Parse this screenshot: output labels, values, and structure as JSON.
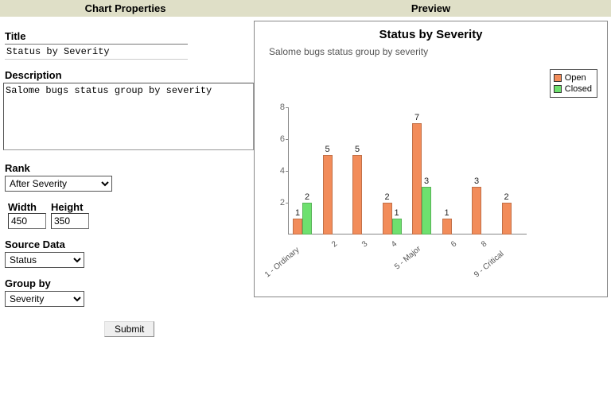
{
  "headers": {
    "left": "Chart Properties",
    "right": "Preview"
  },
  "form": {
    "title_label": "Title",
    "title_value": "Status by Severity",
    "desc_label": "Description",
    "desc_value": "Salome bugs status group by severity",
    "rank_label": "Rank",
    "rank_selected": "After Severity",
    "width_label": "Width",
    "height_label": "Height",
    "width_value": "450",
    "height_value": "350",
    "source_label": "Source Data",
    "source_selected": "Status",
    "group_label": "Group by",
    "group_selected": "Severity",
    "submit_label": "Submit"
  },
  "chart_data": {
    "type": "bar",
    "title": "Status by Severity",
    "subtitle": "Salome bugs status group by severity",
    "xlabel": "",
    "ylabel": "",
    "ylim": [
      0,
      8
    ],
    "yticks": [
      2,
      4,
      6,
      8
    ],
    "legend": {
      "position": "right",
      "entries": [
        "Open",
        "Closed"
      ]
    },
    "categories": [
      "1 - Ordinary",
      "2",
      "3",
      "4",
      "5 - Major",
      "6",
      "8",
      "9 - Critical"
    ],
    "series": [
      {
        "name": "Open",
        "values": [
          1,
          5,
          5,
          2,
          7,
          1,
          3,
          2
        ]
      },
      {
        "name": "Closed",
        "values": [
          2,
          null,
          null,
          1,
          3,
          null,
          null,
          null
        ]
      }
    ]
  }
}
